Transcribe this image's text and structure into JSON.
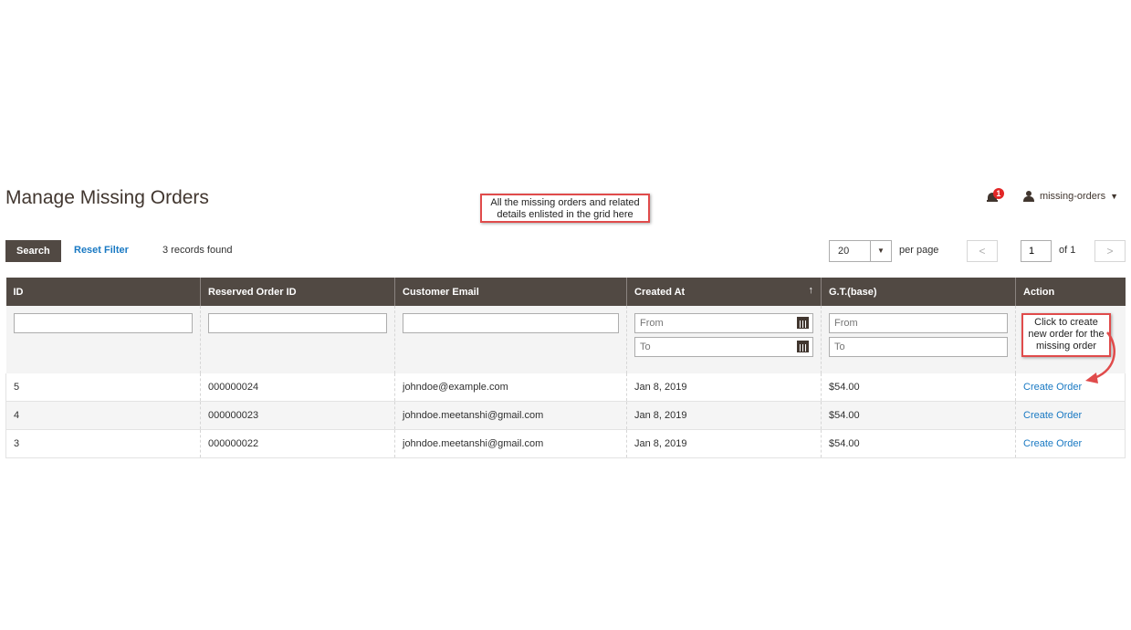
{
  "page": {
    "title": "Manage Missing Orders"
  },
  "header": {
    "notification_count": "1",
    "notification_icon": "bell-icon",
    "user_name": "missing-orders",
    "user_icon": "user-icon",
    "caret": "▼"
  },
  "callouts": {
    "grid_note": "All the missing orders and related details enlisted in the grid here",
    "action_note": "Click to create new order for the missing order"
  },
  "toolbar": {
    "search_label": "Search",
    "reset_label": "Reset Filter",
    "records_text": "3 records found",
    "per_page_value": "20",
    "per_page_label": "per page",
    "prev_glyph": "<",
    "next_glyph": ">",
    "current_page": "1",
    "page_of": "of 1"
  },
  "grid": {
    "columns": [
      "ID",
      "Reserved Order ID",
      "Customer Email",
      "Created At",
      "G.T.(base)",
      "Action"
    ],
    "sort_indicator": "↑",
    "filters": {
      "from_placeholder": "From",
      "to_placeholder": "To"
    },
    "rows": [
      {
        "id": "5",
        "reserved_order_id": "000000024",
        "email": "johndoe@example.com",
        "created_at": "Jan 8, 2019",
        "gt_base": "$54.00",
        "action": "Create Order"
      },
      {
        "id": "4",
        "reserved_order_id": "000000023",
        "email": "johndoe.meetanshi@gmail.com",
        "created_at": "Jan 8, 2019",
        "gt_base": "$54.00",
        "action": "Create Order"
      },
      {
        "id": "3",
        "reserved_order_id": "000000022",
        "email": "johndoe.meetanshi@gmail.com",
        "created_at": "Jan 8, 2019",
        "gt_base": "$54.00",
        "action": "Create Order"
      }
    ]
  },
  "colors": {
    "header_bg": "#514943",
    "link": "#1979c3",
    "callout_border": "#e04b4b",
    "badge": "#e22626"
  }
}
